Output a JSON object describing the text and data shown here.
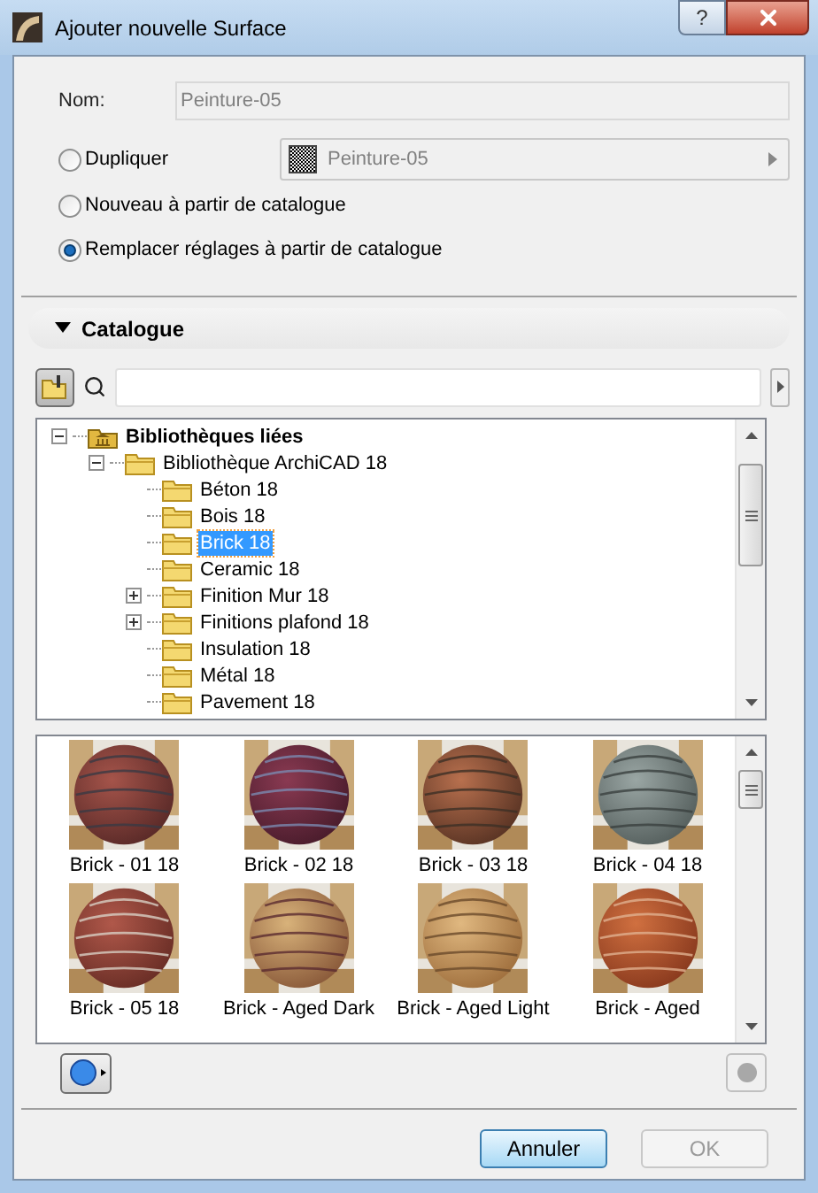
{
  "window": {
    "title": "Ajouter nouvelle Surface",
    "help_button": "?"
  },
  "name_field": {
    "label": "Nom:",
    "value": "Peinture-05",
    "disabled": true
  },
  "options": [
    {
      "label": "Dupliquer",
      "selected": false,
      "source": "Peinture-05"
    },
    {
      "label": "Nouveau à partir de catalogue",
      "selected": false
    },
    {
      "label": "Remplacer réglages à partir de catalogue",
      "selected": true
    }
  ],
  "catalogue": {
    "title": "Catalogue",
    "expanded": true
  },
  "tree": [
    {
      "label": "Bibliothèques liées",
      "kind": "library",
      "expanded": true,
      "selected": false,
      "children": [
        {
          "label": "Bibliothèque ArchiCAD 18",
          "kind": "branch",
          "expanded": true,
          "selected": false,
          "children": [
            {
              "label": "Béton 18",
              "kind": "leaf",
              "selected": false
            },
            {
              "label": "Bois 18",
              "kind": "leaf",
              "selected": false
            },
            {
              "label": "Brick 18",
              "kind": "leaf",
              "selected": true
            },
            {
              "label": "Ceramic 18",
              "kind": "leaf",
              "selected": false
            },
            {
              "label": "Finition Mur 18",
              "kind": "branch",
              "expanded": false,
              "selected": false
            },
            {
              "label": "Finitions plafond 18",
              "kind": "branch",
              "expanded": false,
              "selected": false
            },
            {
              "label": "Insulation 18",
              "kind": "leaf",
              "selected": false
            },
            {
              "label": "Métal 18",
              "kind": "leaf",
              "selected": false
            },
            {
              "label": "Pavement 18",
              "kind": "leaf",
              "selected": false
            }
          ]
        }
      ]
    }
  ],
  "materials": [
    {
      "label": "Brick - 01 18"
    },
    {
      "label": "Brick - 02 18"
    },
    {
      "label": "Brick - 03 18"
    },
    {
      "label": "Brick - 04 18"
    },
    {
      "label": "Brick - 05 18"
    },
    {
      "label": "Brick - Aged Dark"
    },
    {
      "label": "Brick - Aged Light"
    },
    {
      "label": "Brick - Aged"
    }
  ],
  "buttons": [
    {
      "label": "Annuler",
      "disabled": false,
      "default": true
    },
    {
      "label": "OK",
      "disabled": true,
      "default": false
    }
  ]
}
